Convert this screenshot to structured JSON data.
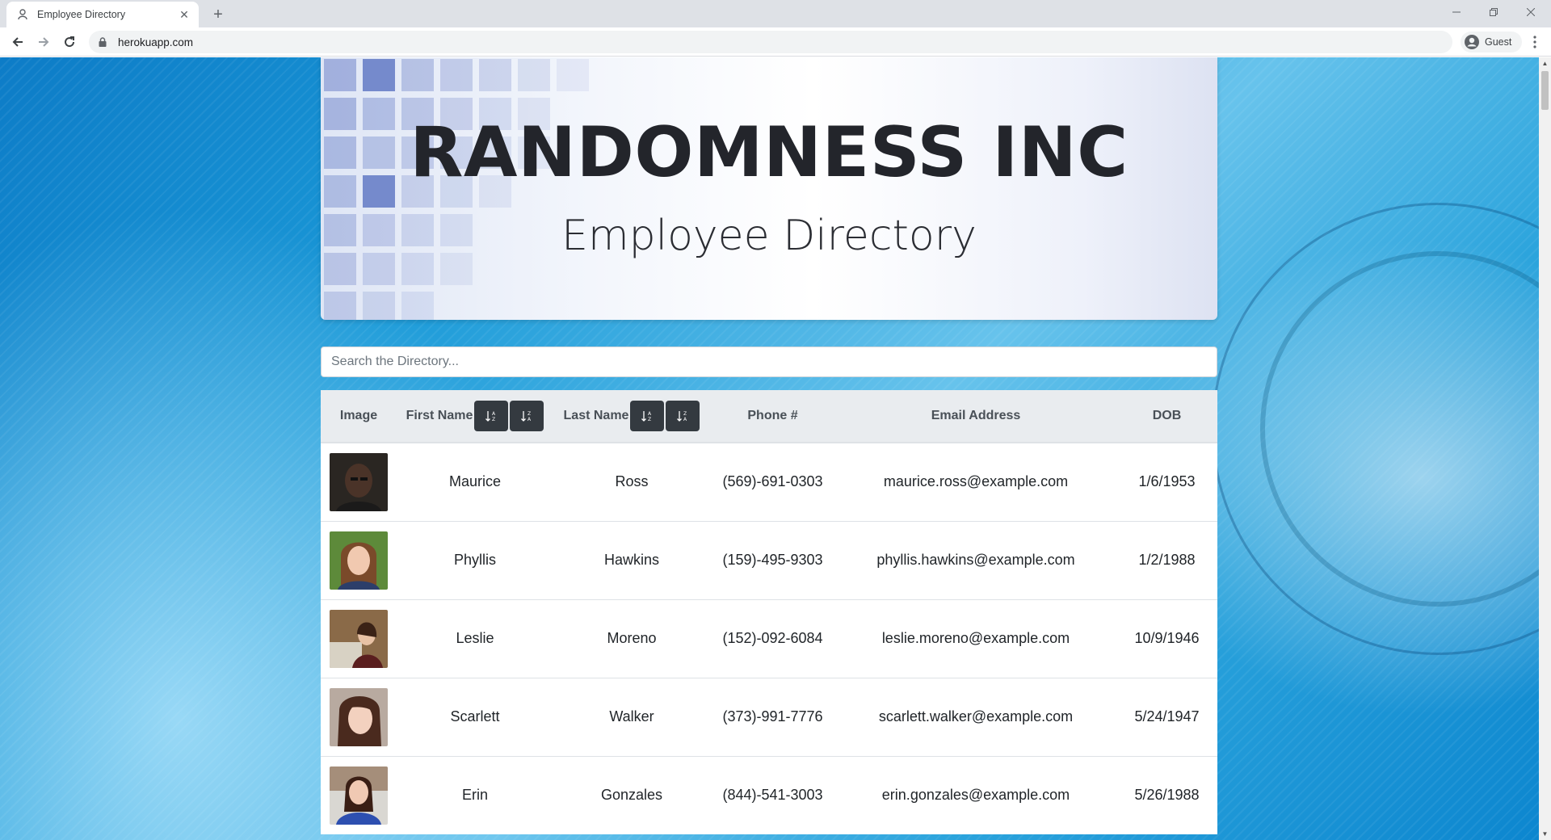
{
  "browser": {
    "tab_title": "Employee Directory",
    "url": "herokuapp.com",
    "profile_name": "Guest"
  },
  "header": {
    "title": "RANDOMNESS INC",
    "subtitle": "Employee Directory"
  },
  "search": {
    "placeholder": "Search the Directory..."
  },
  "table": {
    "columns": {
      "image": "Image",
      "first_name": "First Name",
      "last_name": "Last Name",
      "phone": "Phone #",
      "email": "Email Address",
      "dob": "DOB"
    },
    "rows": [
      {
        "first": "Maurice",
        "last": "Ross",
        "phone": "(569)-691-0303",
        "email": "maurice.ross@example.com",
        "dob": "1/6/1953"
      },
      {
        "first": "Phyllis",
        "last": "Hawkins",
        "phone": "(159)-495-9303",
        "email": "phyllis.hawkins@example.com",
        "dob": "1/2/1988"
      },
      {
        "first": "Leslie",
        "last": "Moreno",
        "phone": "(152)-092-6084",
        "email": "leslie.moreno@example.com",
        "dob": "10/9/1946"
      },
      {
        "first": "Scarlett",
        "last": "Walker",
        "phone": "(373)-991-7776",
        "email": "scarlett.walker@example.com",
        "dob": "5/24/1947"
      },
      {
        "first": "Erin",
        "last": "Gonzales",
        "phone": "(844)-541-3003",
        "email": "erin.gonzales@example.com",
        "dob": "5/26/1988"
      }
    ]
  },
  "colors": {
    "sort_button": "#343a40",
    "table_header": "#e9ecef",
    "background_blue": "#1b9ad8"
  }
}
